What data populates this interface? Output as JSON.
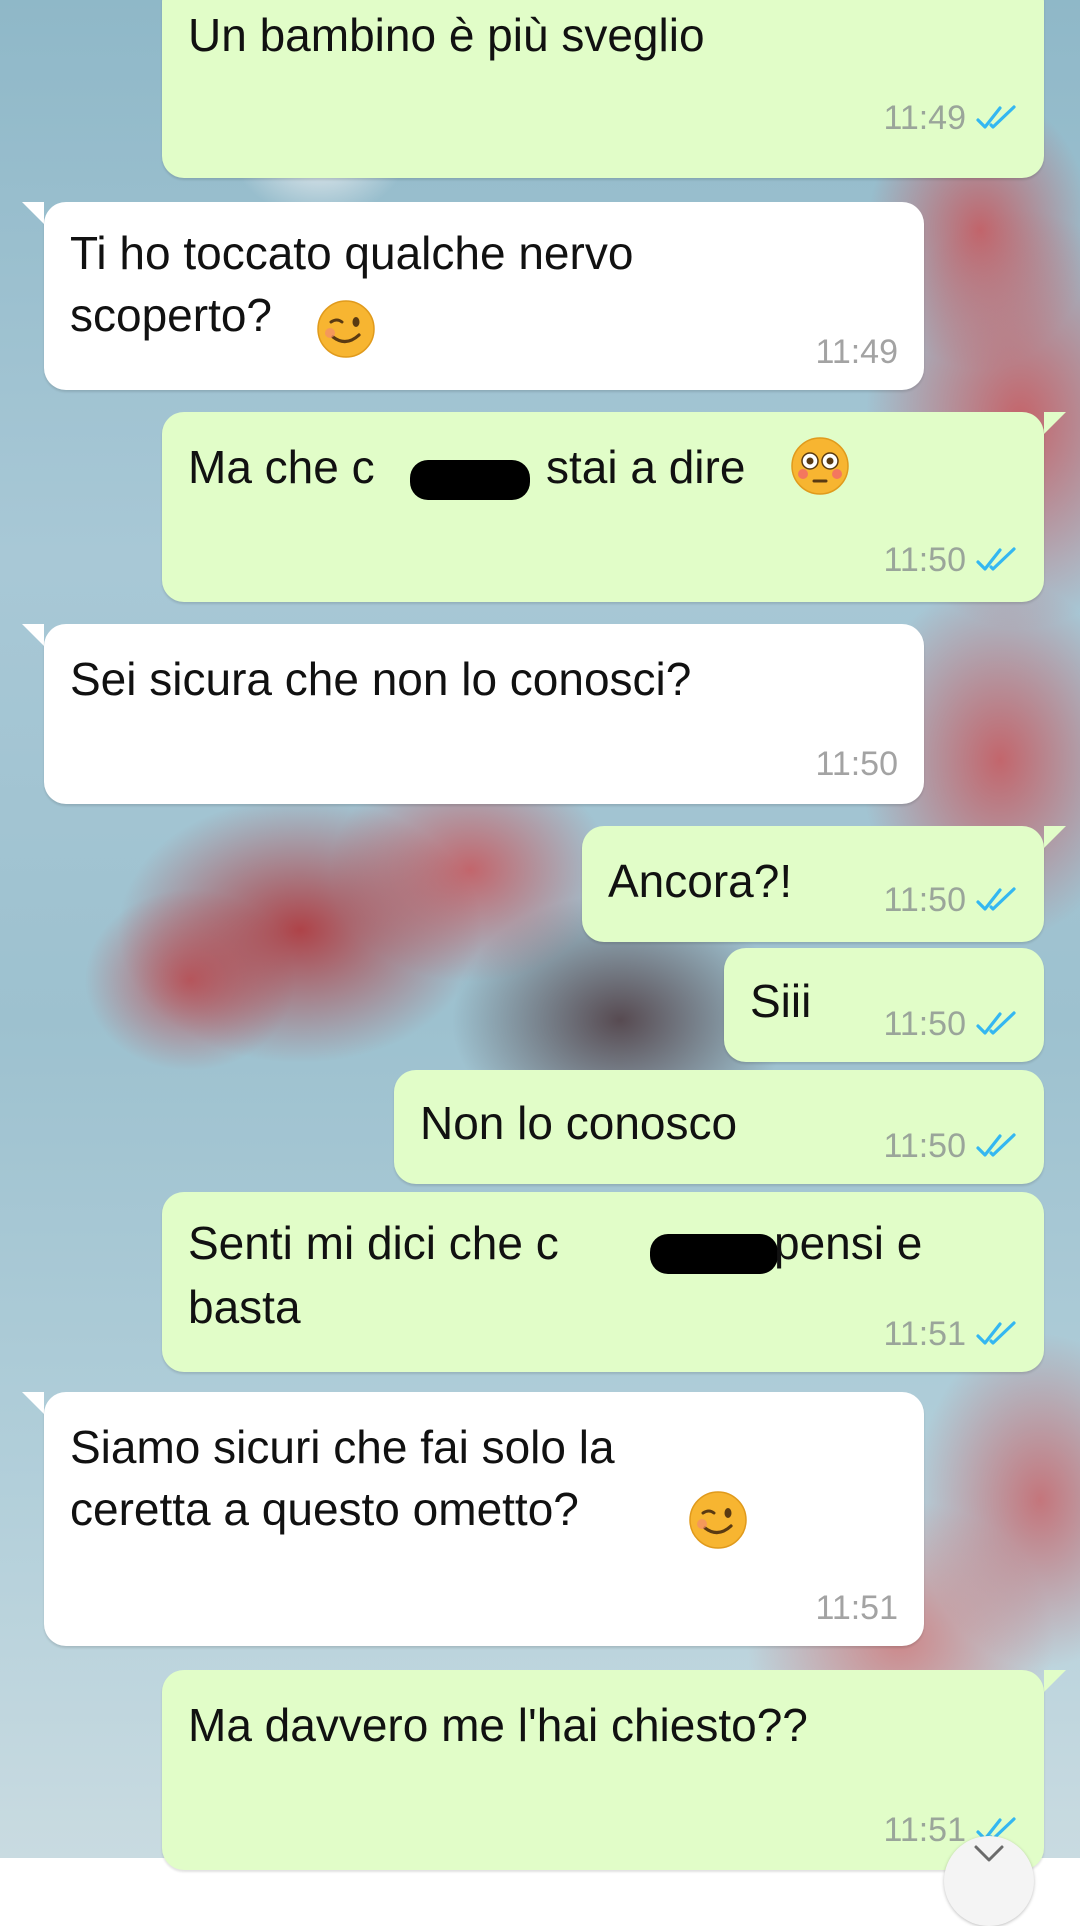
{
  "chat": {
    "messages": [
      {
        "direction": "out",
        "text": "Un bambino è più sveglio",
        "time": "11:49",
        "status": "read"
      },
      {
        "direction": "in",
        "text": "Ti ho toccato qualche nervo\nscoperto?",
        "emoji": "winking-face",
        "time": "11:49"
      },
      {
        "direction": "out",
        "text_before": "Ma che c",
        "text_after": "stai a dire",
        "emoji": "flushed-face",
        "redacted": true,
        "time": "11:50",
        "status": "read"
      },
      {
        "direction": "in",
        "text": "Sei sicura che non lo conosci?",
        "time": "11:50"
      },
      {
        "direction": "out",
        "text": "Ancora?!",
        "time": "11:50",
        "status": "read"
      },
      {
        "direction": "out",
        "text": "Siii",
        "time": "11:50",
        "status": "read"
      },
      {
        "direction": "out",
        "text": "Non lo conosco",
        "time": "11:50",
        "status": "read"
      },
      {
        "direction": "out",
        "text_before": "Senti mi dici che c",
        "text_after": "pensi e",
        "text_line2": "basta",
        "redacted": true,
        "time": "11:51",
        "status": "read"
      },
      {
        "direction": "in",
        "text": "Siamo sicuri che fai solo la\nceretta a questo ometto?",
        "emoji": "winking-face",
        "time": "11:51"
      },
      {
        "direction": "out",
        "text": "Ma davvero me l'hai chiesto??",
        "time": "11:51",
        "status": "read"
      }
    ]
  },
  "colors": {
    "outgoing_bubble": "#e1fdc8",
    "incoming_bubble": "#ffffff",
    "read_ticks": "#34b7f1",
    "timestamp": "#9aa59a"
  },
  "icons": {
    "read_receipt": "double-check-icon",
    "scroll_down": "chevron-down-icon"
  }
}
